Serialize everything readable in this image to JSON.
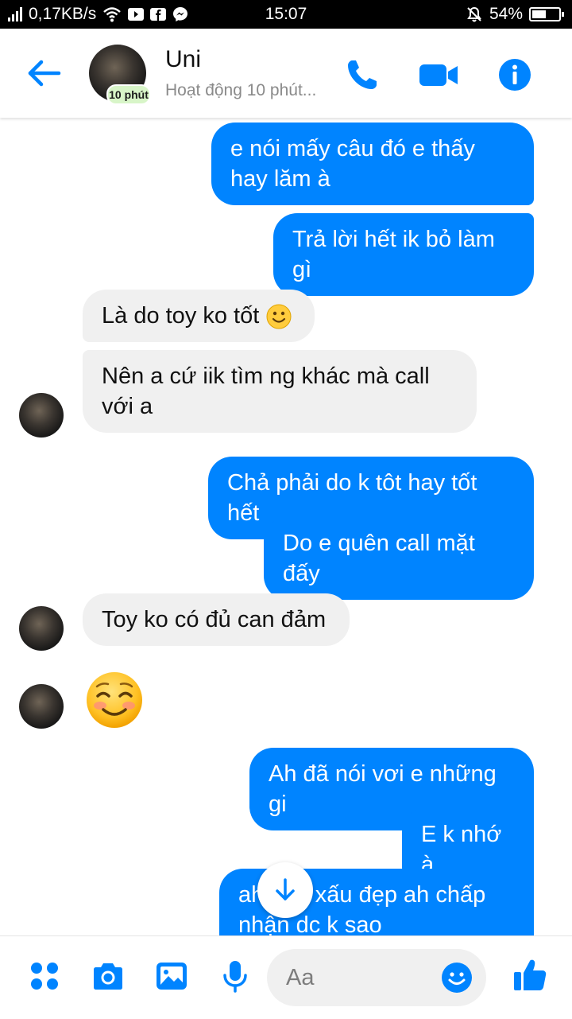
{
  "status": {
    "speed": "0,17KB/s",
    "time": "15:07",
    "battery": "54%",
    "battery_level": 0.54
  },
  "header": {
    "contact_name": "Uni",
    "activity": "Hoạt động 10 phút...",
    "avatar_badge": "10 phút"
  },
  "messages": [
    {
      "side": "out",
      "text": "e nói mấy câu đó e thấy hay lăm à"
    },
    {
      "side": "out",
      "text": "Trả lời hết ik bỏ làm gì"
    },
    {
      "side": "in",
      "text": "Là do toy ko tốt"
    },
    {
      "side": "in",
      "text": "Nên a cứ iik tìm ng khác mà call với a"
    },
    {
      "side": "out",
      "text": "Chả phải do k tôt hay tốt hết"
    },
    {
      "side": "out",
      "text": "Do e quên call mặt đấy"
    },
    {
      "side": "in",
      "text": "Toy ko có đủ can đảm"
    },
    {
      "side": "in",
      "emoji": "smiling-blushing-face"
    },
    {
      "side": "out",
      "text": "Ah đã nói vơi e những gi"
    },
    {
      "side": "out",
      "text": "E k nhớ à"
    },
    {
      "side": "out",
      "text": "ah bảo xấu đẹp ah chấp nhận dc k sao"
    }
  ],
  "composer": {
    "placeholder": "Aa"
  },
  "colors": {
    "accent": "#0084ff",
    "incoming_bubble": "#f0f0f0",
    "status_bar": "#000000"
  }
}
